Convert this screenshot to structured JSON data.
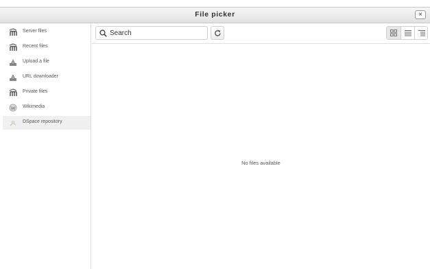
{
  "window": {
    "title": "File picker",
    "close_label": "×"
  },
  "sidebar": {
    "items": [
      {
        "label": "Server files",
        "icon": "moodle-icon",
        "selected": false
      },
      {
        "label": "Recent files",
        "icon": "moodle-icon",
        "selected": false
      },
      {
        "label": "Upload a file",
        "icon": "upload-icon",
        "selected": false
      },
      {
        "label": "URL downloader",
        "icon": "url-download-icon",
        "selected": false
      },
      {
        "label": "Private files",
        "icon": "moodle-icon",
        "selected": false
      },
      {
        "label": "Wikimedia",
        "icon": "wikimedia-icon",
        "selected": false
      },
      {
        "label": "DSpace repository",
        "icon": "dspace-icon",
        "selected": true
      }
    ]
  },
  "toolbar": {
    "search": {
      "placeholder": "Search",
      "value": ""
    },
    "refresh_icon": "refresh-icon",
    "views": [
      {
        "name": "icons",
        "icon": "grid-view-icon",
        "active": true
      },
      {
        "name": "list",
        "icon": "list-view-icon",
        "active": false
      },
      {
        "name": "tree",
        "icon": "tree-view-icon",
        "active": false
      }
    ]
  },
  "content": {
    "empty_message": "No files available"
  },
  "colors": {
    "title_bar": "#e6e6e6",
    "selected_item": "#f0f0f0",
    "border": "#dcdcdc"
  }
}
